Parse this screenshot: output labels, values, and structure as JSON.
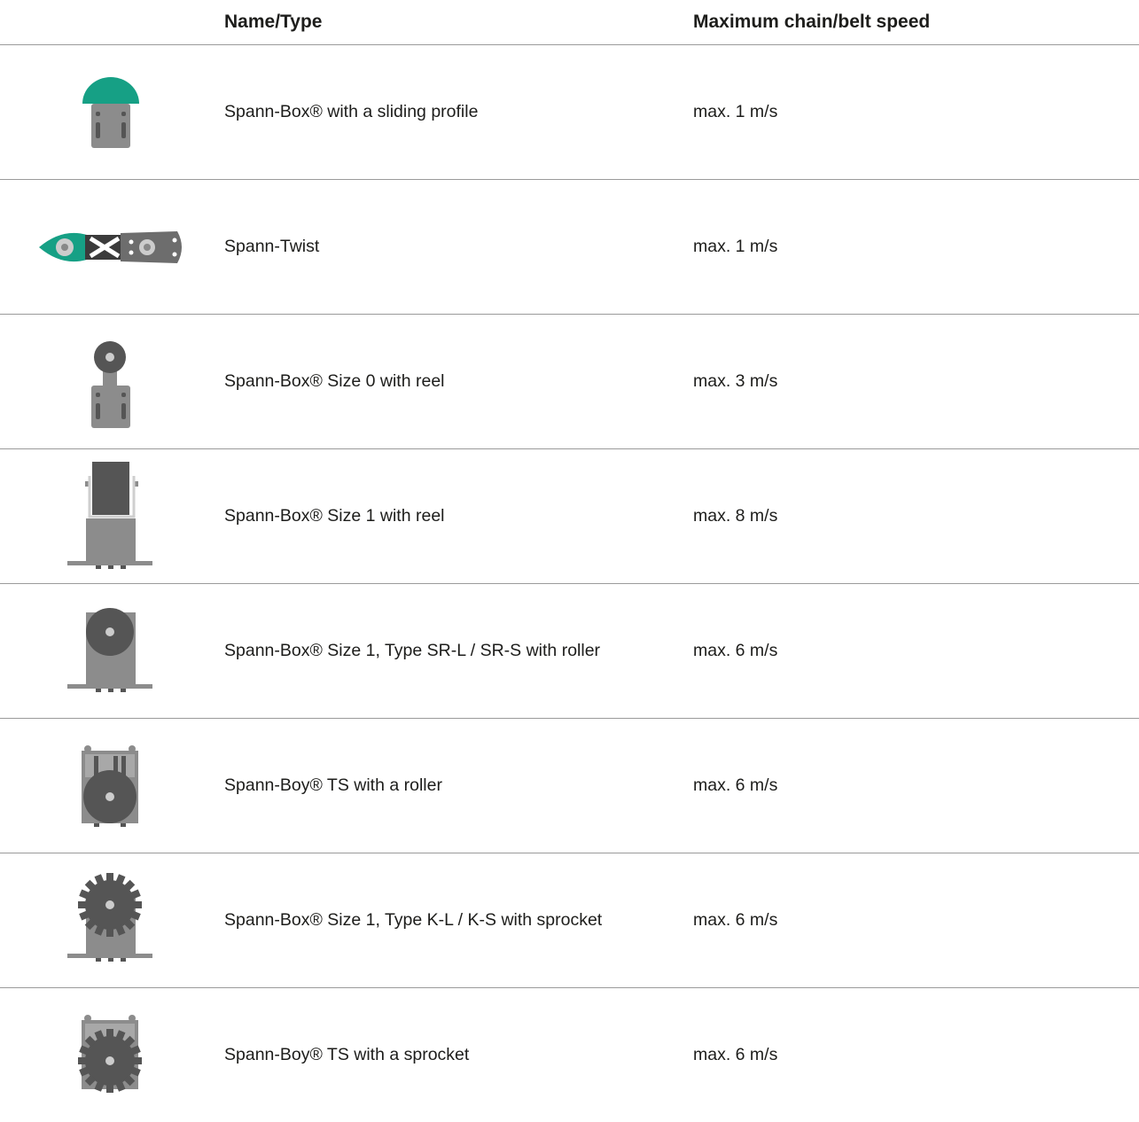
{
  "table": {
    "header": {
      "name_type": "Name/Type",
      "max_speed": "Maximum chain/belt speed"
    },
    "rows": [
      {
        "name": "Spann-Box® with a sliding profile",
        "speed": "max. 1 m/s",
        "icon": "spann-box-sliding-profile-icon"
      },
      {
        "name": "Spann-Twist",
        "speed": "max. 1 m/s",
        "icon": "spann-twist-icon"
      },
      {
        "name": "Spann-Box® Size 0 with reel",
        "speed": "max. 3 m/s",
        "icon": "spann-box-size0-reel-icon"
      },
      {
        "name": "Spann-Box® Size 1 with reel",
        "speed": "max. 8 m/s",
        "icon": "spann-box-size1-reel-icon"
      },
      {
        "name": "Spann-Box® Size 1, Type SR-L / SR-S with roller",
        "speed": "max. 6 m/s",
        "icon": "spann-box-size1-roller-icon"
      },
      {
        "name": "Spann-Boy® TS with a roller",
        "speed": "max. 6 m/s",
        "icon": "spann-boy-roller-icon"
      },
      {
        "name": "Spann-Box® Size 1, Type K-L / K-S with sprocket",
        "speed": "max. 6 m/s",
        "icon": "spann-box-size1-sprocket-icon"
      },
      {
        "name": "Spann-Boy® TS with a sprocket",
        "speed": "max. 6 m/s",
        "icon": "spann-boy-sprocket-icon"
      }
    ],
    "colors": {
      "accent": "#16a085",
      "dark_gray": "#5a5a5a",
      "mid_gray": "#8c8c8c",
      "line": "#9a9a9a"
    }
  }
}
